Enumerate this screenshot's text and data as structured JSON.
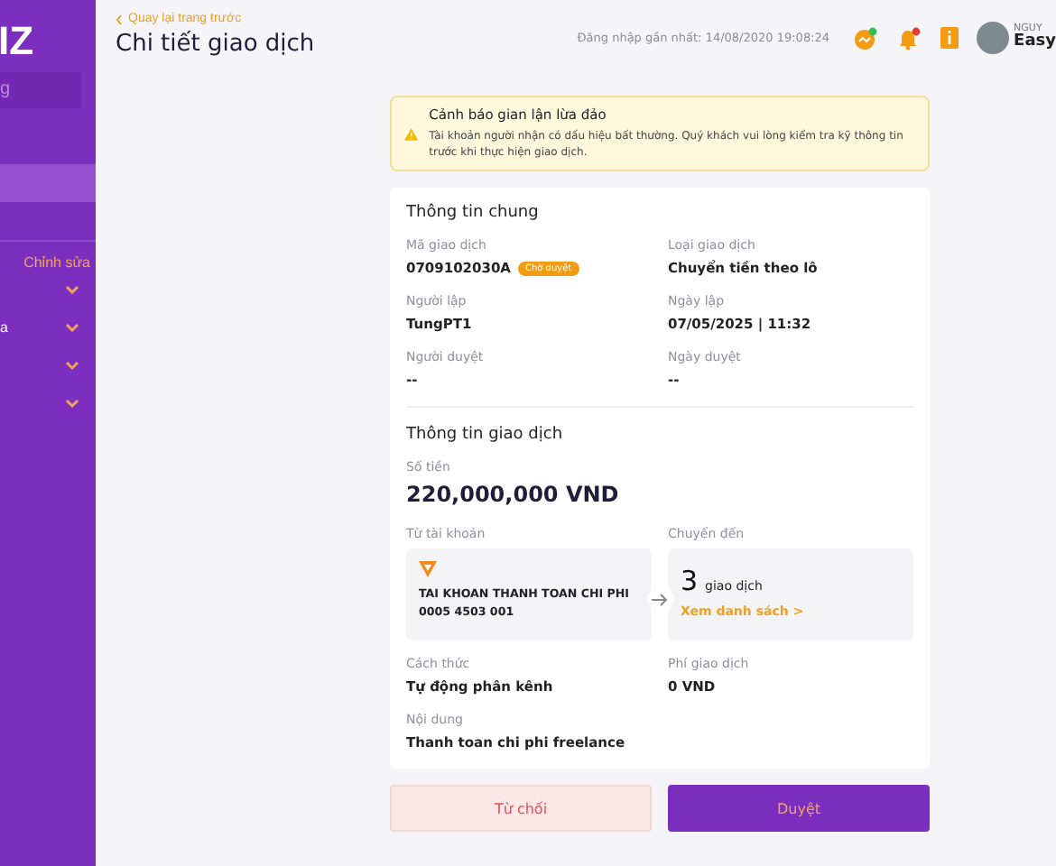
{
  "sidebar": {
    "logo": "IZ",
    "search": {
      "value": "g"
    },
    "items": [
      {
        "selected": false
      },
      {
        "selected": true
      },
      {
        "selected": false
      }
    ],
    "edit_link": "Chỉnh sửa",
    "groups": [
      {
        "expanded": false
      },
      {
        "label": "a",
        "expanded": false
      },
      {
        "expanded": false
      },
      {
        "expanded": false
      }
    ]
  },
  "header": {
    "back_link": "Quay lại trang trước",
    "title": "Chi tiết giao dịch",
    "last_login": "Đăng nhập gần nhất: 14/08/2020 19:08:24",
    "user": {
      "role": "NGUY",
      "name": "Easy"
    },
    "icons": [
      {
        "kind": "chat",
        "color": "#2fbf4f"
      },
      {
        "kind": "bell",
        "color": "#e53935"
      },
      {
        "kind": "info"
      }
    ]
  },
  "warning": {
    "title": "Cảnh báo gian lận lừa đảo",
    "message": "Tài khoản người nhận có dấu hiệu bất thường. Quý khách vui lòng kiểm tra kỹ thông tin trước khi thực hiện giao dịch."
  },
  "general": {
    "title": "Thông tin chung",
    "fields": [
      {
        "label": "Mã giao dịch",
        "value": "0709102030A",
        "badge": "Chờ duyệt"
      },
      {
        "label": "Loại giao dịch",
        "value": "Chuyển tiền theo lô"
      },
      {
        "label": "Người lập",
        "value": "TungPT1"
      },
      {
        "label": "Ngày lập",
        "value": "07/05/2025 | 11:32"
      },
      {
        "label": "Người duyệt",
        "value": "--"
      },
      {
        "label": "Ngày duyệt",
        "value": "--"
      }
    ]
  },
  "transaction": {
    "title": "Thông tin giao dịch",
    "amount_label": "Số tiền",
    "amount": "220,000,000 VND",
    "from_label": "Từ tài khoản",
    "from_account_name": "TAI KHOAN THANH TOAN CHI PHI",
    "from_account_number": "0005 4503 001",
    "to_label": "Chuyển đến",
    "to_count": "3",
    "to_unit": "giao dịch",
    "to_link": "Xem danh sách >",
    "fields": [
      {
        "label": "Cách thức",
        "value": "Tự động phân kênh"
      },
      {
        "label": "Phí giao dịch",
        "value": "0 VND"
      },
      {
        "label": "Nội dung",
        "value": "Thanh toan chi phi freelance"
      }
    ]
  },
  "buttons": [
    {
      "label": "Từ chối",
      "kind": "reject"
    },
    {
      "label": "Duyệt",
      "kind": "approve"
    }
  ]
}
